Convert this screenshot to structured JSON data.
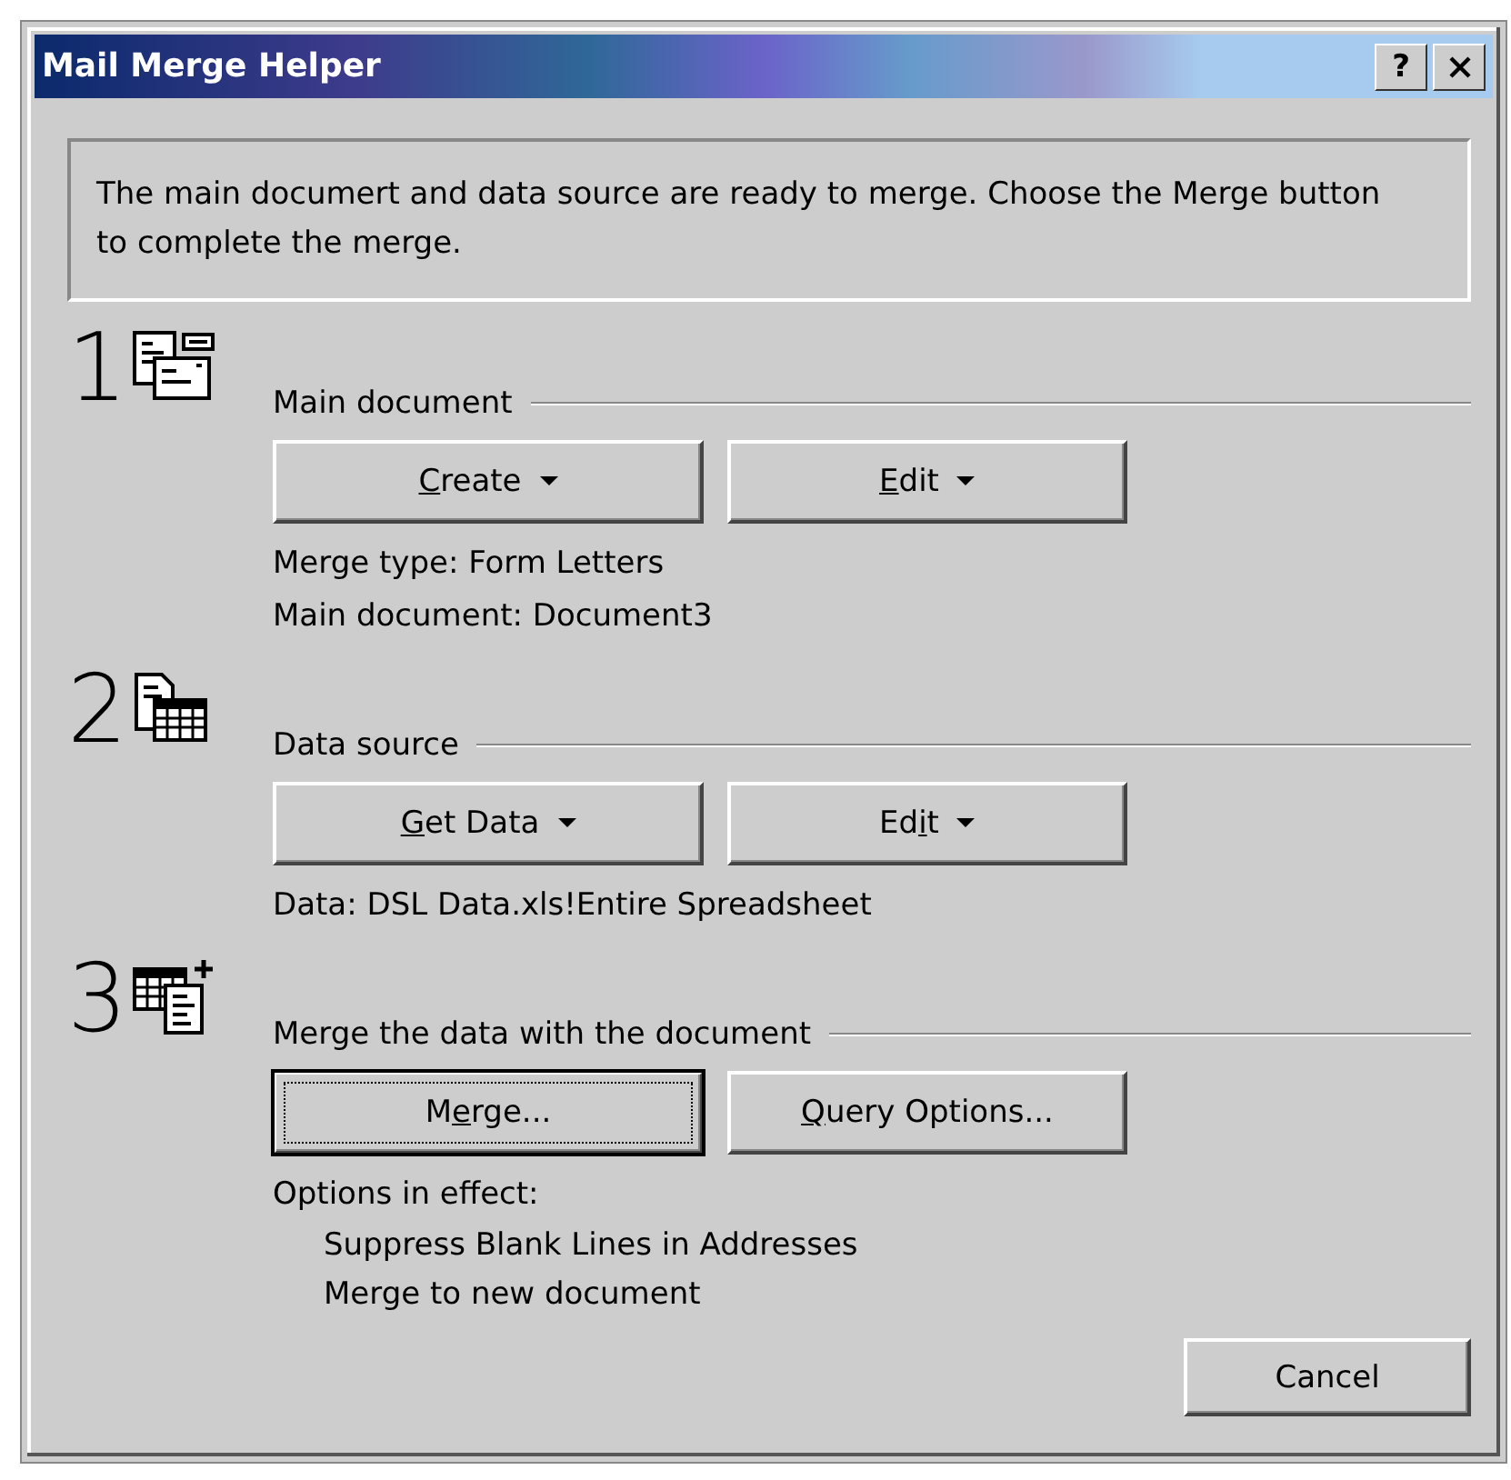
{
  "window": {
    "title": "Mail Merge Helper",
    "help_button": "?"
  },
  "message": "The main documert and data source are ready to merge. Choose the Merge button to complete the merge.",
  "sections": [
    {
      "number": "1",
      "heading": "Main document",
      "buttons": [
        {
          "key": "C",
          "post": "reate",
          "has_menu": true,
          "default": false
        },
        {
          "key": "E",
          "post": "dit",
          "has_menu": true,
          "default": false
        }
      ],
      "details": [
        "Merge type: Form Letters",
        "Main document: Document3"
      ]
    },
    {
      "number": "2",
      "heading": "Data source",
      "buttons": [
        {
          "key": "G",
          "post": "et Data",
          "has_menu": true,
          "default": false
        },
        {
          "pre": "Ed",
          "key": "i",
          "post": "t",
          "has_menu": true,
          "default": false
        }
      ],
      "details": [
        "Data: DSL Data.xls!Entire Spreadsheet"
      ]
    },
    {
      "number": "3",
      "heading": "Merge the data with the document",
      "buttons": [
        {
          "pre": "M",
          "key": "e",
          "post": "rge...",
          "has_menu": false,
          "default": true
        },
        {
          "key": "Q",
          "post": "uery Options...",
          "has_menu": false,
          "default": false
        }
      ],
      "details": [
        "Options in effect:"
      ],
      "indented_details": [
        "Suppress Blank Lines in Addresses",
        "Merge to new document"
      ]
    }
  ],
  "cancel_button": {
    "pre": "Cancel",
    "has_menu": false,
    "default": false
  }
}
